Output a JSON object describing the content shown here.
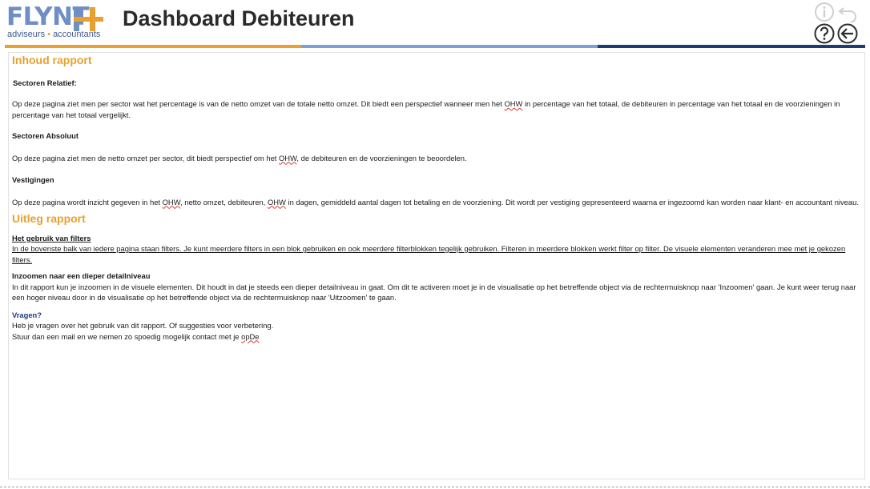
{
  "header": {
    "logo_word": "FLYNTH",
    "logo_sub_left": "adviseurs",
    "logo_sub_sep": "•",
    "logo_sub_right": "accountants",
    "title": "Dashboard Debiteuren"
  },
  "icons": [
    "info-icon",
    "undo-icon",
    "help-icon",
    "back-arrow-icon"
  ],
  "colors": {
    "orange": "#e8a030",
    "mid_blue": "#7ba1d4",
    "navy": "#1e3c6e"
  },
  "content": {
    "inhoud_title": "Inhoud rapport",
    "relatief_heading": "Sectoren Relatief:",
    "relatief_text": {
      "a": "Op deze pagina ziet men per sector wat het percentage is van de netto omzet van de totale netto omzet. Dit biedt een perspectief wanneer men het ",
      "ohw": "OHW",
      "b": " in percentage van het totaal, de debiteuren in percentage van het totaal en de voorzieningen in percentage van het totaal vergelijkt."
    },
    "absoluut_heading": "Sectoren Absoluut",
    "absoluut_text": {
      "a": "Op deze pagina ziet men de netto omzet per sector, dit biedt perspectief om het ",
      "ohw": "OHW",
      "b": ", de debiteuren en de voorzieningen te beoordelen."
    },
    "vestigingen_heading": "Vestigingen",
    "vestigingen_text": {
      "a": "Op deze pagina wordt inzicht gegeven in het ",
      "ohw1": "OHW",
      "b": ", netto omzet, debiteuren, ",
      "ohw2": "OHW",
      "c": " in dagen, gemiddeld aantal dagen tot betaling en de voorziening. Dit wordt per vestiging gepresenteerd waarna er ingezoomd kan worden naar klant- en accountant niveau."
    },
    "uitleg_title": "Uitleg rapport",
    "filters_heading": "Het gebruik van filters",
    "filters_text": "In de bovenste balk van iedere pagina staan filters. Je kunt meerdere filters in een blok gebruiken en ook meerdere filterblokken tegelijk gebruiken. Filteren in meerdere blokken werkt filter op filter. De visuele elementen veranderen mee met je gekozen filters.",
    "inzoomen_heading": "Inzoomen naar een dieper detailniveau",
    "inzoomen_text": "In dit rapport kun je inzoomen in de visuele elementen. Dit houdt in dat je steeds een dieper detailniveau in gaat. Om dit te activeren moet je in de visualisatie op het betreffende object via de rechtermuisknop naar 'Inzoomen' gaan.  Je kunt weer terug naar een hoger niveau door in de visualisatie op het betreffende object via de rechtermuisknop naar 'Uitzoomen' te gaan.",
    "vragen_heading": "Vragen?",
    "vragen_line1": "Heb je vragen over het gebruik van dit rapport. Of suggesties voor verbetering.",
    "vragen_line2_a": "Stuur dan een mail en we nemen zo spoedig mogelijk contact met je ",
    "vragen_line2_b": "opDe"
  }
}
